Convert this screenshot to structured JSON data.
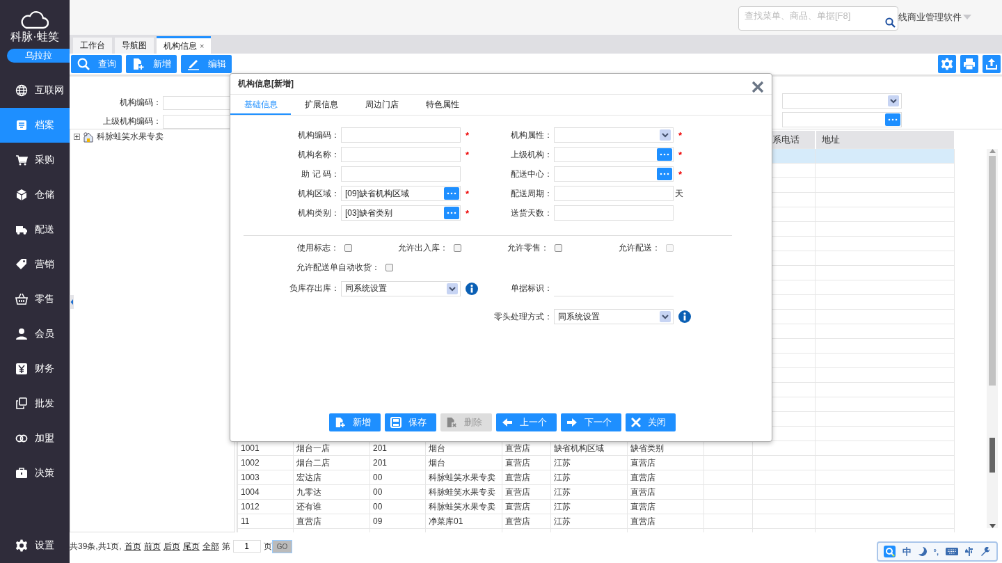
{
  "sidebar": {
    "logo": "科脉·蛙笑",
    "user": "乌拉拉",
    "items": [
      {
        "label": "互联网",
        "selected": false
      },
      {
        "label": "档案",
        "selected": true
      },
      {
        "label": "采购",
        "selected": false
      },
      {
        "label": "仓储",
        "selected": false
      },
      {
        "label": "配送",
        "selected": false
      },
      {
        "label": "营销",
        "selected": false
      },
      {
        "label": "零售",
        "selected": false
      },
      {
        "label": "会员",
        "selected": false
      },
      {
        "label": "财务",
        "selected": false
      },
      {
        "label": "批发",
        "selected": false
      },
      {
        "label": "加盟",
        "selected": false
      },
      {
        "label": "决策",
        "selected": false
      }
    ],
    "settings": "设置"
  },
  "header": {
    "search_placeholder": "查找菜单、商品、单据[F8]",
    "product": "线商业管理软件"
  },
  "tabs": [
    {
      "label": "工作台",
      "selected": false
    },
    {
      "label": "导航图",
      "selected": false
    },
    {
      "label": "机构信息",
      "selected": true,
      "close": "×"
    }
  ],
  "toolbar": [
    {
      "label": "查询"
    },
    {
      "label": "新增"
    },
    {
      "label": "编辑"
    }
  ],
  "filters": [
    {
      "label": "机构编码："
    },
    {
      "label": "上级机构编码："
    }
  ],
  "tree": [
    {
      "label": "科脉蛙笑水果专卖",
      "expanded": false
    }
  ],
  "table": {
    "headers": [
      "系电话",
      "地址"
    ],
    "rows": [
      {
        "selected": true,
        "cells": []
      },
      {
        "selected": false,
        "cells": [
          "1001",
          "烟台一店",
          "201",
          "烟台",
          "直营店",
          "缺省机构区域",
          "缺省类别"
        ]
      },
      {
        "selected": false,
        "cells": [
          "1002",
          "烟台二店",
          "201",
          "烟台",
          "直营店",
          "江苏",
          "直营店"
        ]
      },
      {
        "selected": false,
        "cells": [
          "1003",
          "宏达店",
          "00",
          "科脉蛙笑水果专卖",
          "直营店",
          "江苏",
          "直营店"
        ]
      },
      {
        "selected": false,
        "cells": [
          "1004",
          "九零达",
          "00",
          "科脉蛙笑水果专卖",
          "直营店",
          "江苏",
          "直营店"
        ]
      },
      {
        "selected": false,
        "cells": [
          "1012",
          "还有谁",
          "00",
          "科脉蛙笑水果专卖",
          "直营店",
          "江苏",
          "直营店"
        ]
      },
      {
        "selected": false,
        "cells": [
          "11",
          "直营店",
          "09",
          "净菜库01",
          "直营店",
          "江苏",
          "直营店"
        ]
      }
    ]
  },
  "pager": {
    "summary": "共39条,共1页,",
    "links": [
      "首页",
      "前页",
      "后页",
      "尾页",
      "全部"
    ],
    "prefix": "第",
    "page": "1",
    "suffix": "页",
    "go": "GO"
  },
  "ime": {
    "mode": "中",
    "punct": "°,"
  },
  "dialog": {
    "title": "机构信息[新增]",
    "tabs": [
      {
        "label": "基础信息",
        "selected": true
      },
      {
        "label": "扩展信息",
        "selected": false
      },
      {
        "label": "周边门店",
        "selected": false
      },
      {
        "label": "特色属性",
        "selected": false
      }
    ],
    "fields": [
      {
        "label": "机构编码：",
        "kind": "text",
        "mark": "*"
      },
      {
        "label": "机构属性：",
        "kind": "select",
        "mark": "*"
      },
      {
        "label": "机构名称：",
        "kind": "text",
        "mark": "*"
      },
      {
        "label": "上级机构：",
        "kind": "lookup",
        "mark": "*"
      },
      {
        "label": "助 记 码：",
        "kind": "text"
      },
      {
        "label": "配送中心：",
        "kind": "lookup",
        "mark": "*"
      },
      {
        "label": "机构区域：",
        "kind": "lookup",
        "value": "[09]缺省机构区域",
        "mark": "*"
      },
      {
        "label": "配送周期：",
        "kind": "text",
        "suffix": "天"
      },
      {
        "label": "机构类别：",
        "kind": "lookup",
        "value": "[03]缺省类别",
        "mark": "*"
      },
      {
        "label": "送货天数：",
        "kind": "text"
      }
    ],
    "checks": [
      {
        "label": "使用标志：",
        "checked": false,
        "disabled": false
      },
      {
        "label": "允许出入库：",
        "checked": false,
        "disabled": false
      },
      {
        "label": "允许零售：",
        "checked": false,
        "disabled": false
      },
      {
        "label": "允许配送：",
        "checked": false,
        "disabled": true
      }
    ],
    "auto_receive": {
      "label": "允许配送单自动收货：",
      "checked": false
    },
    "options": [
      {
        "label": "负库存出库：",
        "kind": "select",
        "value": "同系统设置",
        "info": true
      },
      {
        "label": "单据标识：",
        "kind": "line"
      },
      {
        "label": "零头处理方式：",
        "kind": "select",
        "value": "同系统设置",
        "info": true
      }
    ],
    "buttons": [
      {
        "label": "新增",
        "disabled": false
      },
      {
        "label": "保存",
        "disabled": false
      },
      {
        "label": "删除",
        "disabled": true
      },
      {
        "label": "上一个",
        "disabled": false
      },
      {
        "label": "下一个",
        "disabled": false
      },
      {
        "label": "关闭",
        "disabled": false
      }
    ]
  }
}
